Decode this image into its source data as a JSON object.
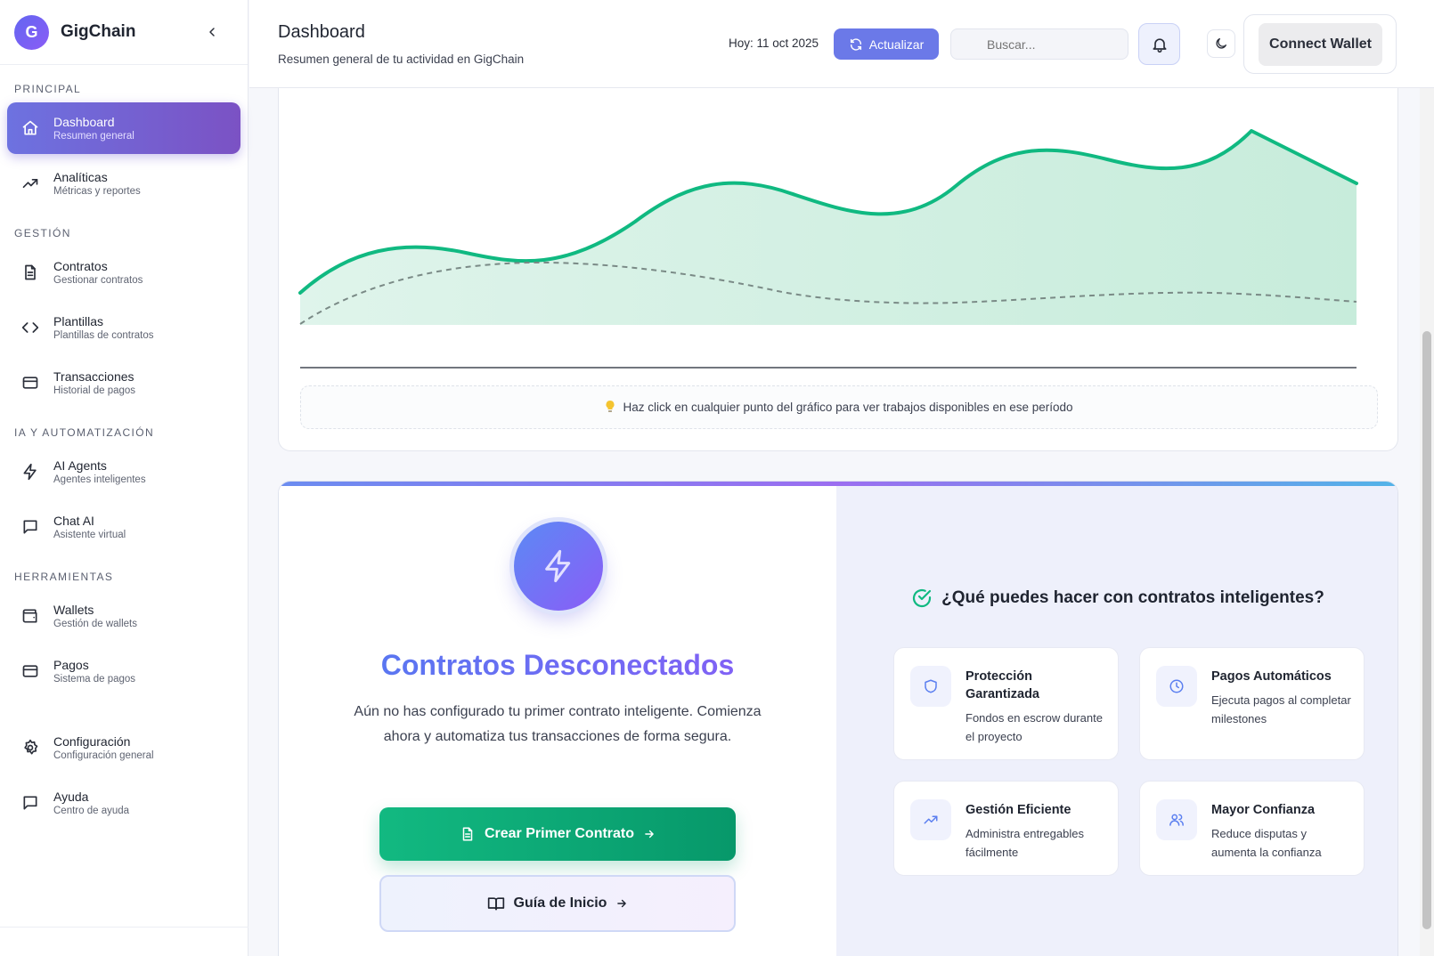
{
  "brand": {
    "initial": "G",
    "name": "GigChain"
  },
  "sidebar": {
    "sections": [
      {
        "title": "PRINCIPAL",
        "items": [
          {
            "label": "Dashboard",
            "sub": "Resumen general",
            "icon": "home-icon",
            "active": true
          },
          {
            "label": "Analíticas",
            "sub": "Métricas y reportes",
            "icon": "trending-up-icon"
          }
        ]
      },
      {
        "title": "GESTIÓN",
        "items": [
          {
            "label": "Contratos",
            "sub": "Gestionar contratos",
            "icon": "document-icon"
          },
          {
            "label": "Plantillas",
            "sub": "Plantillas de contratos",
            "icon": "code-icon"
          },
          {
            "label": "Transacciones",
            "sub": "Historial de pagos",
            "icon": "credit-card-icon"
          }
        ]
      },
      {
        "title": "IA Y AUTOMATIZACIÓN",
        "items": [
          {
            "label": "AI Agents",
            "sub": "Agentes inteligentes",
            "icon": "bolt-icon"
          },
          {
            "label": "Chat AI",
            "sub": "Asistente virtual",
            "icon": "chat-icon"
          }
        ]
      },
      {
        "title": "HERRAMIENTAS",
        "items": [
          {
            "label": "Wallets",
            "sub": "Gestión de wallets",
            "icon": "wallet-icon"
          },
          {
            "label": "Pagos",
            "sub": "Sistema de pagos",
            "icon": "credit-card-icon"
          }
        ]
      },
      {
        "title": "",
        "items": [
          {
            "label": "Configuración",
            "sub": "Configuración general",
            "icon": "gear-icon"
          },
          {
            "label": "Ayuda",
            "sub": "Centro de ayuda",
            "icon": "chat-icon"
          }
        ]
      }
    ]
  },
  "header": {
    "title": "Dashboard",
    "subtitle": "Resumen general de tu actividad en GigChain",
    "today": "Hoy: 11 oct 2025",
    "refresh_label": "Actualizar",
    "search_placeholder": "Buscar...",
    "wallet_label": "Connect Wallet"
  },
  "chart": {
    "hint": "Haz click en cualquier punto del gráfico para ver trabajos disponibles en ese período",
    "colors": {
      "line": "#10b981",
      "fill": "#d3f1e4",
      "dashed": "#7a8a86"
    }
  },
  "contracts": {
    "title": "Contratos Desconectados",
    "description": "Aún no has configurado tu primer contrato inteligente. Comienza ahora y automatiza tus transacciones de forma segura.",
    "create_label": "Crear Primer Contrato",
    "guide_label": "Guía de Inicio",
    "features_title": "¿Qué puedes hacer con contratos inteligentes?",
    "features": [
      {
        "title": "Protección Garantizada",
        "desc": "Fondos en escrow durante el proyecto",
        "icon": "shield-icon"
      },
      {
        "title": "Pagos Automáticos",
        "desc": "Ejecuta pagos al completar milestones",
        "icon": "clock-icon"
      },
      {
        "title": "Gestión Eficiente",
        "desc": "Administra entregables fácilmente",
        "icon": "trending-up-icon"
      },
      {
        "title": "Mayor Confianza",
        "desc": "Reduce disputas y aumenta la confianza",
        "icon": "users-icon"
      }
    ]
  }
}
